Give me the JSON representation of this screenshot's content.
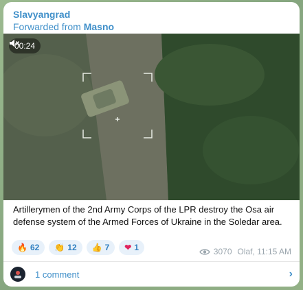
{
  "post": {
    "channel": "Slavyangrad",
    "forwarded_prefix": "Forwarded from",
    "forwarded_source": "Masno",
    "video": {
      "duration": "00:24",
      "mute_icon": "speaker-muted-icon"
    },
    "caption": "Artillerymen of the 2nd Army Corps of the LPR destroy the Osa air defense system of the Armed Forces of Ukraine in the Soledar area.",
    "reactions": [
      {
        "emoji": "🔥",
        "count": "62"
      },
      {
        "emoji": "👏",
        "count": "12"
      },
      {
        "emoji": "👍",
        "count": "7"
      },
      {
        "emoji": "❤",
        "count": "1"
      }
    ],
    "views": "3070",
    "author_time": "Olaf, 11:15 AM",
    "comments_label": "1 comment"
  },
  "colors": {
    "accent": "#3f8fc9",
    "reaction_bg": "#e8f1fa",
    "meta": "#9aa5ad"
  }
}
